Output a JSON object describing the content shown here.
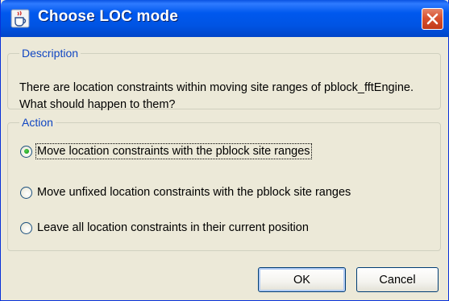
{
  "window": {
    "title": "Choose LOC mode",
    "icon": "java-coffee-cup-icon",
    "accent_color": "#0054e3",
    "close_color": "#d8512f"
  },
  "description": {
    "legend": "Description",
    "text": "There are location constraints within moving site ranges of pblock_fftEngine. What should happen to them?"
  },
  "action": {
    "legend": "Action",
    "options": [
      {
        "label": "Move location constraints with the pblock site ranges",
        "selected": true
      },
      {
        "label": "Move unfixed location constraints with the pblock site ranges",
        "selected": false
      },
      {
        "label": "Leave all location constraints in their current position",
        "selected": false
      }
    ]
  },
  "buttons": {
    "ok_label": "OK",
    "cancel_label": "Cancel"
  }
}
